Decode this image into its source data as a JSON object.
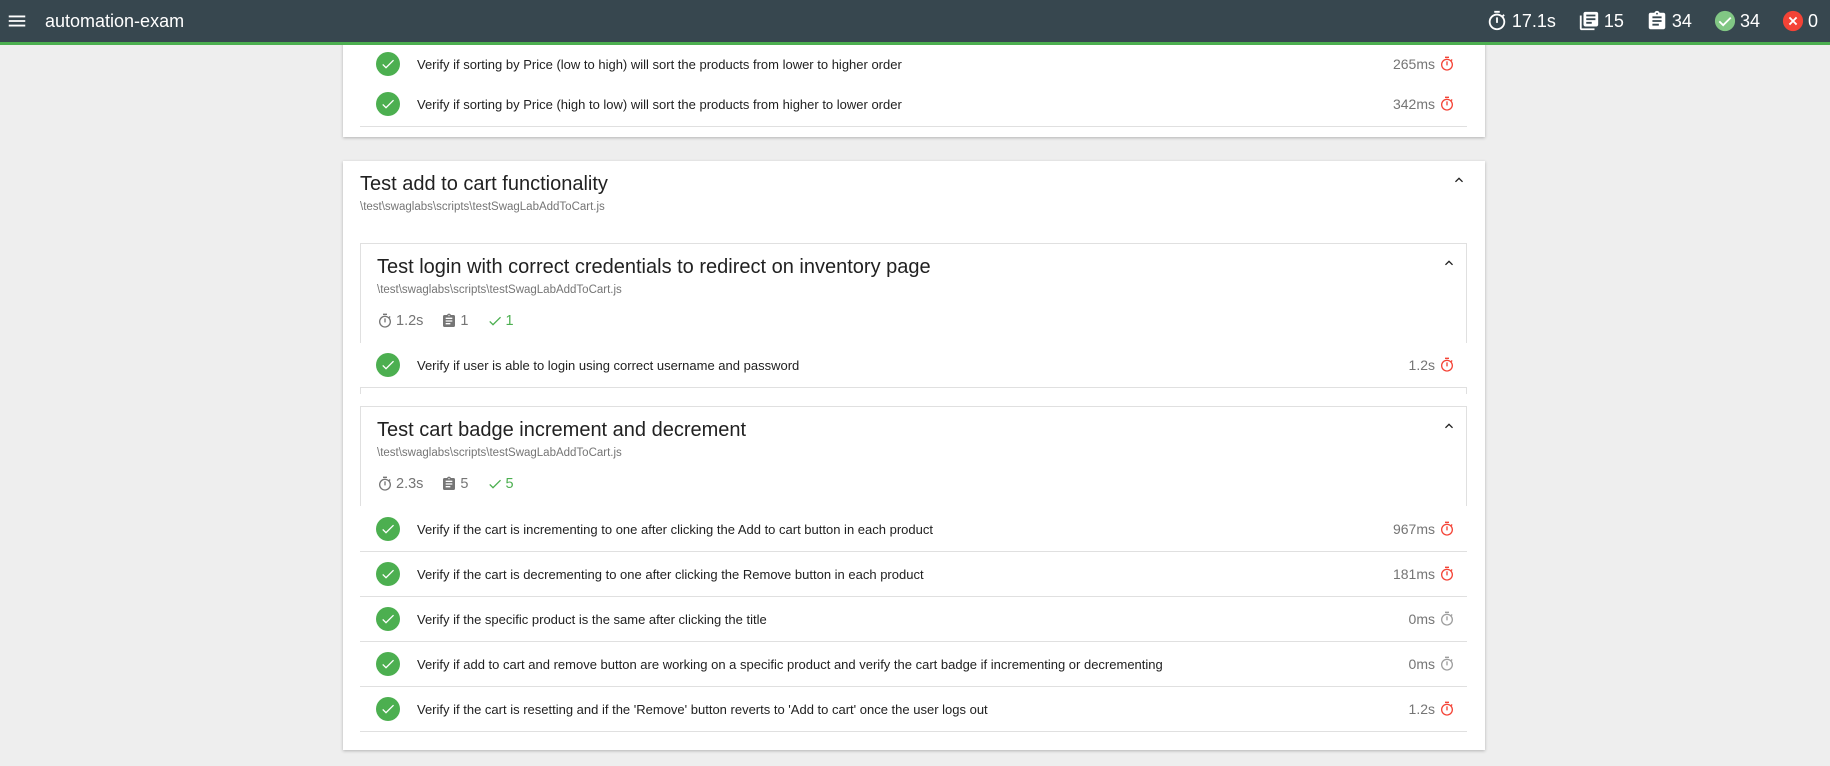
{
  "app": {
    "title": "automation-exam"
  },
  "stats": {
    "duration": "17.1s",
    "suites": "15",
    "tests": "34",
    "passed": "34",
    "failed": "0"
  },
  "colors": {
    "topbar": "#37474f",
    "pass": "#4caf50",
    "fail": "#f44336",
    "slow_timer": "#f44336",
    "timer": "#9e9e9e"
  },
  "prev_tests": [
    {
      "title": "Verify if sorting by Price (low to high) will sort the products from lower to higher order",
      "duration": "265ms"
    },
    {
      "title": "Verify if sorting by Price (high to low) will sort the products from higher to lower order",
      "duration": "342ms"
    }
  ],
  "suite": {
    "title": "Test add to cart functionality",
    "file": "\\test\\swaglabs\\scripts\\testSwagLabAddToCart.js",
    "subsuites": [
      {
        "title": "Test login with correct credentials to redirect on inventory page",
        "file": "\\test\\swaglabs\\scripts\\testSwagLabAddToCart.js",
        "duration": "1.2s",
        "tests": "1",
        "passed": "1",
        "tests_list": [
          {
            "title": "Verify if user is able to login using correct username and password",
            "duration": "1.2s"
          }
        ]
      },
      {
        "title": "Test cart badge increment and decrement",
        "file": "\\test\\swaglabs\\scripts\\testSwagLabAddToCart.js",
        "duration": "2.3s",
        "tests": "5",
        "passed": "5",
        "tests_list": [
          {
            "title": "Verify if the cart is incrementing to one after clicking the Add to cart button in each product",
            "duration": "967ms"
          },
          {
            "title": "Verify if the cart is decrementing to one after clicking the Remove button in each product",
            "duration": "181ms"
          },
          {
            "title": "Verify if the specific product is the same after clicking the title",
            "duration": "0ms"
          },
          {
            "title": "Verify if add to cart and remove button are working on a specific product and verify the cart badge if incrementing or decrementing",
            "duration": "0ms"
          },
          {
            "title": "Verify if the cart is resetting and if the 'Remove' button reverts to 'Add to cart' once the user logs out",
            "duration": "1.2s"
          }
        ]
      }
    ]
  }
}
